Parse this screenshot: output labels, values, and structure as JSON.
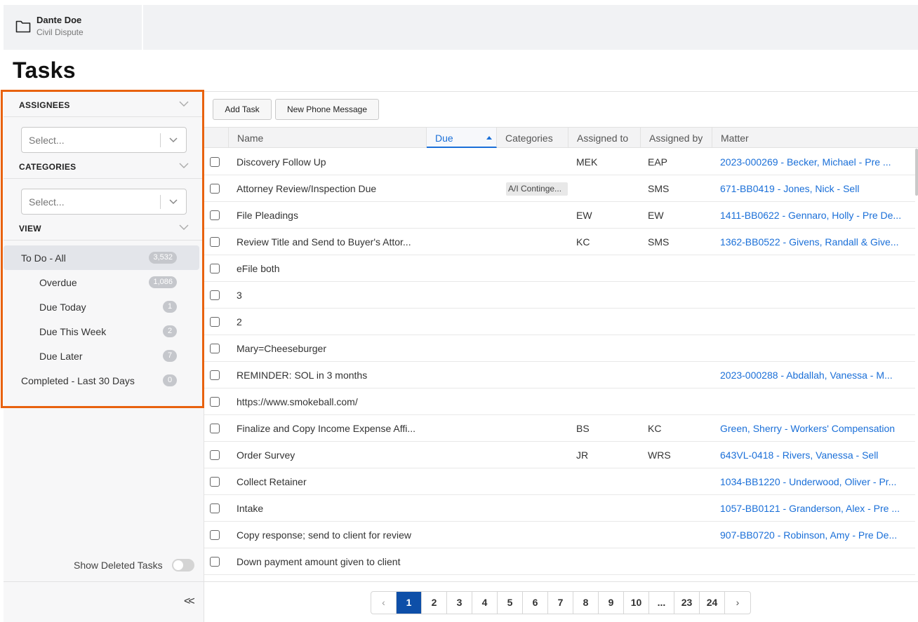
{
  "header": {
    "matter_name": "Dante Doe",
    "matter_type": "Civil Dispute"
  },
  "page_title": "Tasks",
  "sidebar": {
    "assignees": {
      "label": "ASSIGNEES",
      "placeholder": "Select..."
    },
    "categories": {
      "label": "CATEGORIES",
      "placeholder": "Select..."
    },
    "view": {
      "label": "VIEW",
      "items": [
        {
          "label": "To Do - All",
          "count": "3,532"
        },
        {
          "label": "Overdue",
          "count": "1,086"
        },
        {
          "label": "Due Today",
          "count": "1"
        },
        {
          "label": "Due This Week",
          "count": "2"
        },
        {
          "label": "Due Later",
          "count": "7"
        },
        {
          "label": "Completed - Last 30 Days",
          "count": "0"
        }
      ]
    },
    "show_deleted_label": "Show Deleted Tasks",
    "collapse_glyph": "<<"
  },
  "toolbar": {
    "add_task": "Add Task",
    "new_phone_message": "New Phone Message"
  },
  "columns": {
    "name": "Name",
    "due": "Due",
    "categories": "Categories",
    "assigned_to": "Assigned to",
    "assigned_by": "Assigned by",
    "matter": "Matter"
  },
  "rows": [
    {
      "name": "Discovery Follow Up",
      "category": "",
      "assigned_to": "MEK",
      "assigned_by": "EAP",
      "matter": "2023-000269 - Becker, Michael - Pre ..."
    },
    {
      "name": "Attorney Review/Inspection Due",
      "category": "A/I Continge...",
      "assigned_to": "",
      "assigned_by": "SMS",
      "matter": "671-BB0419 - Jones, Nick - Sell"
    },
    {
      "name": "File Pleadings",
      "category": "",
      "assigned_to": "EW",
      "assigned_by": "EW",
      "matter": "1411-BB0622 - Gennaro, Holly - Pre De..."
    },
    {
      "name": "Review Title and Send to Buyer's Attor...",
      "category": "",
      "assigned_to": "KC",
      "assigned_by": "SMS",
      "matter": "1362-BB0522 - Givens, Randall & Give..."
    },
    {
      "name": "eFile both",
      "category": "",
      "assigned_to": "",
      "assigned_by": "",
      "matter": ""
    },
    {
      "name": "3",
      "category": "",
      "assigned_to": "",
      "assigned_by": "",
      "matter": ""
    },
    {
      "name": "2",
      "category": "",
      "assigned_to": "",
      "assigned_by": "",
      "matter": ""
    },
    {
      "name": "Mary=Cheeseburger",
      "category": "",
      "assigned_to": "",
      "assigned_by": "",
      "matter": ""
    },
    {
      "name": "REMINDER: SOL in 3 months",
      "category": "",
      "assigned_to": "",
      "assigned_by": "",
      "matter": "2023-000288 - Abdallah, Vanessa - M..."
    },
    {
      "name": "https://www.smokeball.com/",
      "category": "",
      "assigned_to": "",
      "assigned_by": "",
      "matter": ""
    },
    {
      "name": "Finalize and Copy Income Expense Affi...",
      "category": "",
      "assigned_to": "BS",
      "assigned_by": "KC",
      "matter": "Green, Sherry - Workers' Compensation"
    },
    {
      "name": "Order Survey",
      "category": "",
      "assigned_to": "JR",
      "assigned_by": "WRS",
      "matter": "643VL-0418 - Rivers, Vanessa - Sell"
    },
    {
      "name": "Collect Retainer",
      "category": "",
      "assigned_to": "",
      "assigned_by": "",
      "matter": "1034-BB1220 - Underwood, Oliver - Pr..."
    },
    {
      "name": "Intake",
      "category": "",
      "assigned_to": "",
      "assigned_by": "",
      "matter": "1057-BB0121 - Granderson, Alex - Pre ..."
    },
    {
      "name": "Copy response; send to client for review",
      "category": "",
      "assigned_to": "",
      "assigned_by": "",
      "matter": "907-BB0720 - Robinson, Amy - Pre De..."
    },
    {
      "name": "Down payment amount given to client",
      "category": "",
      "assigned_to": "",
      "assigned_by": "",
      "matter": ""
    }
  ],
  "pagination": {
    "prev": "‹",
    "next": "›",
    "pages": [
      "1",
      "2",
      "3",
      "4",
      "5",
      "6",
      "7",
      "8",
      "9",
      "10",
      "...",
      "23",
      "24"
    ],
    "active": "1"
  }
}
